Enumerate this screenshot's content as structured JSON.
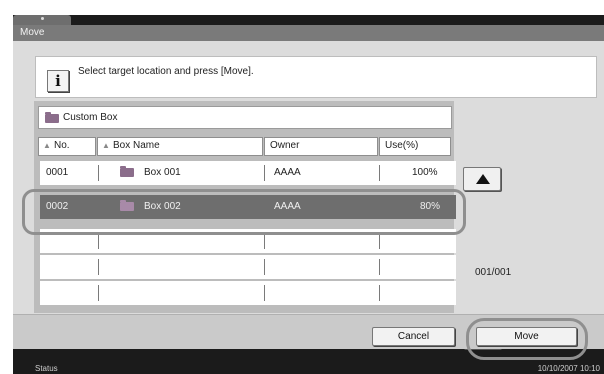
{
  "window": {
    "title": "Move"
  },
  "message": "Select target location and press [Move].",
  "path": "Custom Box",
  "columns": [
    {
      "label": "No."
    },
    {
      "label": "Box Name"
    },
    {
      "label": "Owner"
    },
    {
      "label": "Use(%)"
    }
  ],
  "rows": [
    {
      "no": "0001",
      "name": "Box 001",
      "owner": "AAAA",
      "use": "100%",
      "selected": false
    },
    {
      "no": "0002",
      "name": "Box 002",
      "owner": "AAAA",
      "use": "80%",
      "selected": true
    }
  ],
  "pager": {
    "text": "001/001"
  },
  "buttons": {
    "cancel": "Cancel",
    "move": "Move"
  },
  "status": {
    "label": "Status",
    "datetime": "10/10/2007 10:10"
  },
  "colors": {
    "selected_row": "#6e6e6e",
    "background": "#dcdcdc",
    "title_bar": "#7a7a7a"
  }
}
